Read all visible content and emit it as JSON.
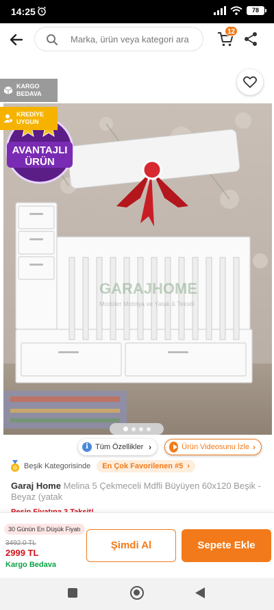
{
  "status_bar": {
    "time": "14:25",
    "battery": "78"
  },
  "header": {
    "search_placeholder": "Marka, ürün veya kategori ara",
    "cart_count": "12"
  },
  "gallery": {
    "tags": [
      {
        "line1": "KARGO",
        "line2": "BEDAVA",
        "color": "#9a9a9a",
        "icon": "box-icon"
      },
      {
        "line1": "KREDİYE",
        "line2": "UYGUN",
        "color": "#f5b300",
        "icon": "credit-user-icon"
      }
    ],
    "sticker_text": [
      "AVANTAJLI",
      "ÜRÜN"
    ],
    "watermark": {
      "brand": "GARAJHOME",
      "sub": "Modüler Mobilya ve Yatak & Tekstil"
    },
    "page_count": 4,
    "active_page": 1
  },
  "pills": {
    "features": "Tüm Özellikler",
    "video": "Ürün Videosunu İzle"
  },
  "category": {
    "prefix": "Beşik Kategorisinde",
    "badge": "En Çok Favorilenen #5"
  },
  "product": {
    "brand": "Garaj Home",
    "name": "Melina 5 Çekmeceli Mdfli Büyüyen 60x120 Beşik - Beyaz (yatak",
    "installment": "Peşin Fiyatına 3 Taksit!"
  },
  "pricing": {
    "lowest_label": "30 Günün En Düşük Fiyatı",
    "old_price": "3492.0 TL",
    "new_price": "2999 TL",
    "shipping": "Kargo Bedava"
  },
  "actions": {
    "buy_now": "Şimdi Al",
    "add_to_cart": "Sepete Ekle"
  },
  "colors": {
    "accent": "#f27a1a",
    "price_red": "#d2131b",
    "shipping_green": "#0ba245"
  }
}
